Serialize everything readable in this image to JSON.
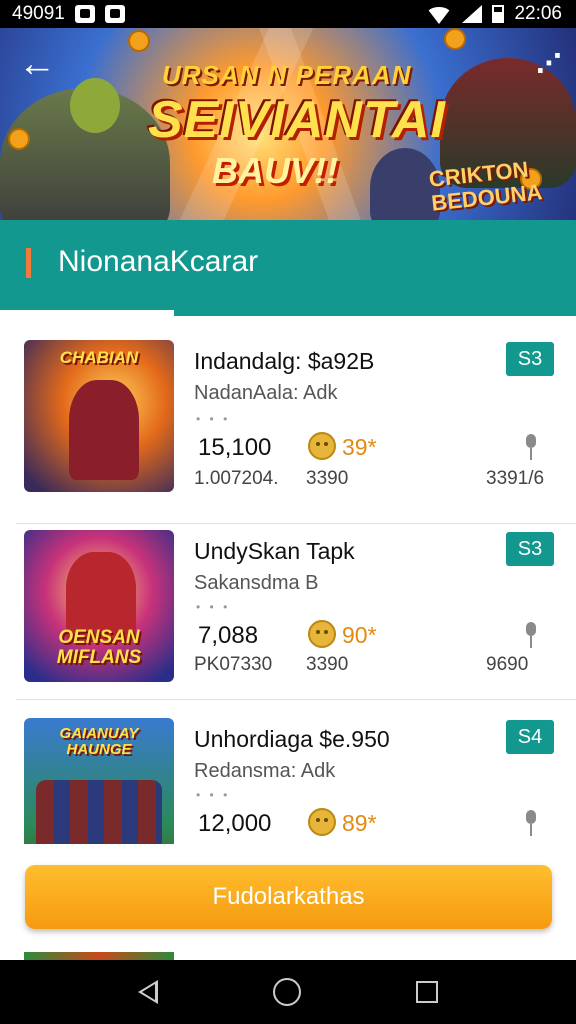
{
  "status_bar": {
    "time_left": "49091",
    "time_right": "22:06"
  },
  "banner": {
    "line1": "URSAN N PERAAN",
    "line2": "SEIVIANTAI",
    "line3": "BAUV!!",
    "side": [
      "CRIKTON",
      "BEDOUNA"
    ]
  },
  "header": {
    "title": "NionanaKcarar"
  },
  "items": [
    {
      "thumb_text": "CHABIAN",
      "title": "Indandalg: $a92B",
      "subtitle": "NadanAala: Adk",
      "dots": "• • •",
      "count": "15,100",
      "rating": "39*",
      "small_left": "1.007204.",
      "small_mid": "3390",
      "badge": "S3",
      "small_right": "3391/6"
    },
    {
      "thumb_text": "OENSAN MIFLANS",
      "title": "UndySkan Tapk",
      "subtitle": "Sakansdma B",
      "dots": "• • •",
      "count": "7,088",
      "rating": "90*",
      "small_left": "PK07330",
      "small_mid": "3390",
      "badge": "S3",
      "small_right": "9690"
    },
    {
      "thumb_text": "GAIANUAY HAUNGE",
      "title": "Unhordiaga $e.950",
      "subtitle": "Redansma: Adk",
      "dots": "• • •",
      "count": "12,000",
      "rating": "89*",
      "small_left": "",
      "small_mid": "",
      "badge": "S4",
      "small_right": ""
    }
  ],
  "cta": {
    "label": "Fudolarkathas"
  },
  "colors": {
    "teal": "#12988e",
    "orange": "#f69a10",
    "rating": "#e38a12"
  }
}
